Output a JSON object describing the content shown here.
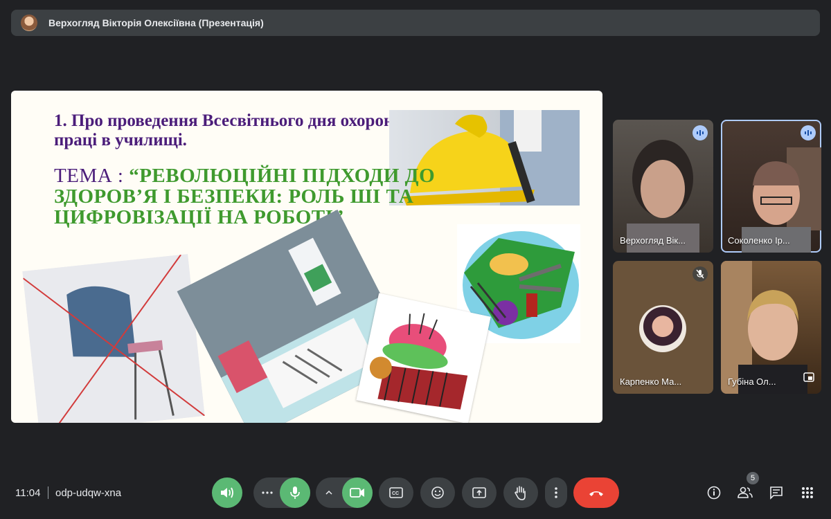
{
  "presenter_bar": {
    "title": "Верхогляд Вікторія Олексіївна (Презентація)"
  },
  "slide": {
    "heading": " 1. Про проведення Всесвітнього дня охорони праці в училищі.",
    "topic_label": "ТЕМА : ",
    "topic_text": "“РЕВОЛЮЦІЙНІ ПІДХОДИ ДО ЗДОРОВ’Я І БЕЗПЕКИ: РОЛЬ ШІ ТА ЦИФРОВІЗАЦІЇ НА РОБОТІ”"
  },
  "participants": [
    {
      "name": "Верхогляд Вік...",
      "status": "speaking"
    },
    {
      "name": "Соколенко Ір...",
      "status": "speaking"
    },
    {
      "name": "Карпенко Ма...",
      "status": "muted"
    },
    {
      "name": "Губіна Ол...",
      "status": "pinned"
    }
  ],
  "bottom_bar": {
    "time": "11:04",
    "meeting_code": "odp-udqw-xna",
    "people_count": "5"
  },
  "colors": {
    "background": "#202124",
    "button": "#3c4043",
    "active_green": "#5bb974",
    "end_call_red": "#ea4335",
    "speaking_blue": "#aecbfa"
  },
  "icons": [
    "speaker-icon",
    "more-icon",
    "mic-icon",
    "chevron-up-icon",
    "camera-icon",
    "captions-icon",
    "emoji-icon",
    "present-icon",
    "raise-hand-icon",
    "more-vert-icon",
    "hang-up-icon",
    "info-icon",
    "people-icon",
    "chat-icon",
    "activities-icon"
  ]
}
